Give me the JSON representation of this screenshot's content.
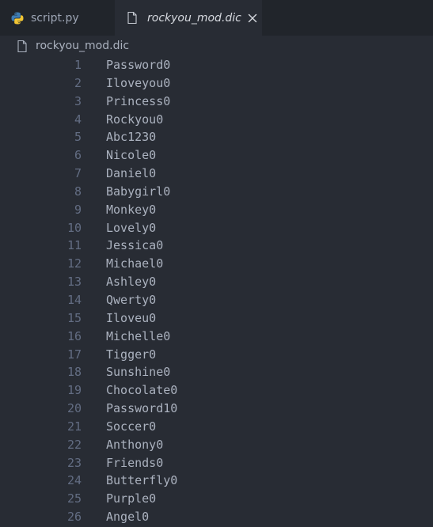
{
  "tabs": [
    {
      "label": "script.py",
      "icon": "python-icon",
      "active": false
    },
    {
      "label": "rockyou_mod.dic",
      "icon": "file-icon",
      "active": true,
      "close": "×"
    }
  ],
  "breadcrumb": {
    "label": "rockyou_mod.dic",
    "icon": "file-icon"
  },
  "editor": {
    "lines": [
      {
        "n": "1",
        "text": "Password0"
      },
      {
        "n": "2",
        "text": "Iloveyou0"
      },
      {
        "n": "3",
        "text": "Princess0"
      },
      {
        "n": "4",
        "text": "Rockyou0"
      },
      {
        "n": "5",
        "text": "Abc1230"
      },
      {
        "n": "6",
        "text": "Nicole0"
      },
      {
        "n": "7",
        "text": "Daniel0"
      },
      {
        "n": "8",
        "text": "Babygirl0"
      },
      {
        "n": "9",
        "text": "Monkey0"
      },
      {
        "n": "10",
        "text": "Lovely0"
      },
      {
        "n": "11",
        "text": "Jessica0"
      },
      {
        "n": "12",
        "text": "Michael0"
      },
      {
        "n": "13",
        "text": "Ashley0"
      },
      {
        "n": "14",
        "text": "Qwerty0"
      },
      {
        "n": "15",
        "text": "Iloveu0"
      },
      {
        "n": "16",
        "text": "Michelle0"
      },
      {
        "n": "17",
        "text": "Tigger0"
      },
      {
        "n": "18",
        "text": "Sunshine0"
      },
      {
        "n": "19",
        "text": "Chocolate0"
      },
      {
        "n": "20",
        "text": "Password10"
      },
      {
        "n": "21",
        "text": "Soccer0"
      },
      {
        "n": "22",
        "text": "Anthony0"
      },
      {
        "n": "23",
        "text": "Friends0"
      },
      {
        "n": "24",
        "text": "Butterfly0"
      },
      {
        "n": "25",
        "text": "Purple0"
      },
      {
        "n": "26",
        "text": "Angel0"
      }
    ]
  },
  "colors": {
    "editor_bg": "#282c34",
    "tabbar_bg": "#21252b",
    "text": "#abb2bf",
    "line_number": "#636d83"
  }
}
